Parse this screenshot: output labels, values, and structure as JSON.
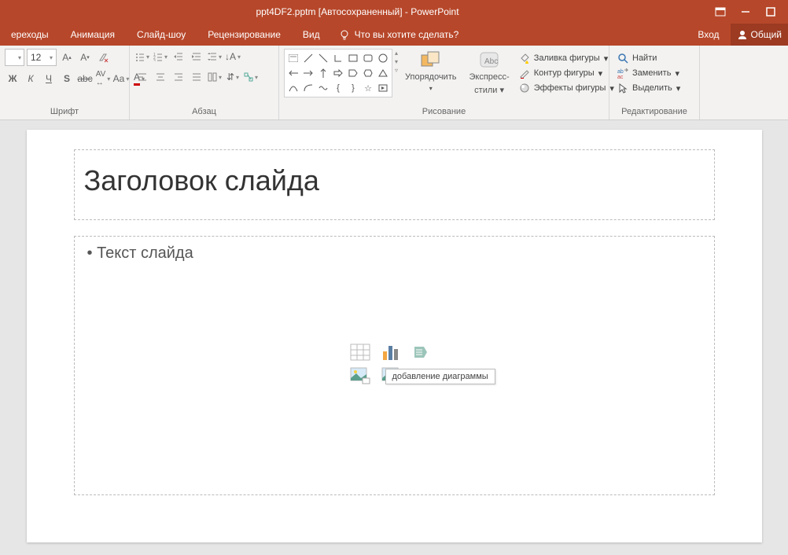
{
  "title": "ppt4DF2.pptm [Автосохраненный] - PowerPoint",
  "menu": {
    "transitions": "ереходы",
    "animation": "Анимация",
    "slideshow": "Слайд-шоу",
    "review": "Рецензирование",
    "view": "Вид",
    "tellme": "Что вы хотите сделать?",
    "signin": "Вход",
    "share": "Общий"
  },
  "ribbon": {
    "font_size": "12",
    "font_label": "Шрифт",
    "para_label": "Абзац",
    "draw_label": "Рисование",
    "edit_label": "Редактирование",
    "arrange": "Упорядочить",
    "express_styles_1": "Экспресс-",
    "express_styles_2": "стили",
    "fill": "Заливка фигуры",
    "outline": "Контур фигуры",
    "effects": "Эффекты фигуры",
    "find": "Найти",
    "replace": "Заменить",
    "select": "Выделить"
  },
  "slide": {
    "title": "Заголовок слайда",
    "body": "Текст слайда",
    "tooltip": "добавление диаграммы"
  }
}
